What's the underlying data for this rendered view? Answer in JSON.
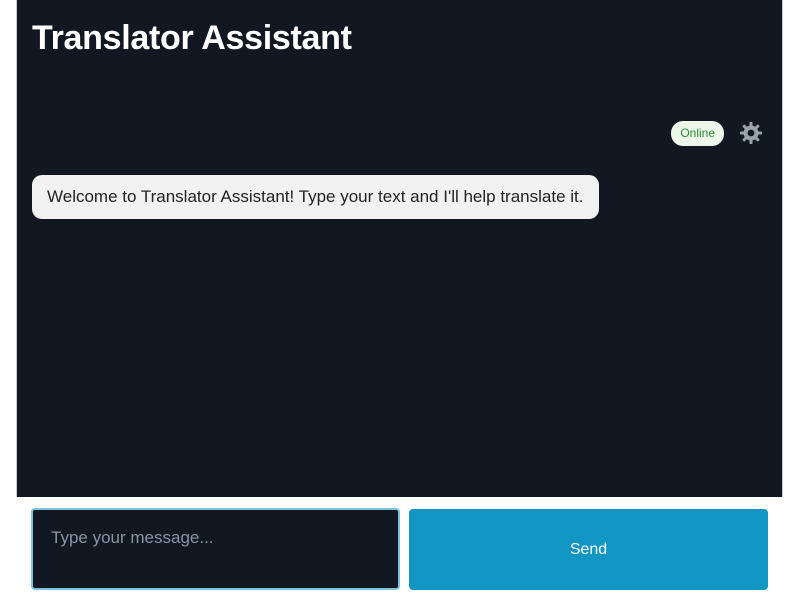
{
  "header": {
    "title": "Translator Assistant"
  },
  "status": {
    "label": "Online",
    "color": "#2d8a36",
    "background": "#ecf7ea"
  },
  "settings": {
    "icon": "gear-icon"
  },
  "messages": [
    {
      "text": "Welcome to Translator Assistant! Type your text and I'll help translate it."
    }
  ],
  "composer": {
    "placeholder": "Type your message...",
    "value": "",
    "send_label": "Send"
  },
  "colors": {
    "app_background": "#121821",
    "send_button": "#1196c4",
    "input_focus_border": "#7cc1de"
  }
}
